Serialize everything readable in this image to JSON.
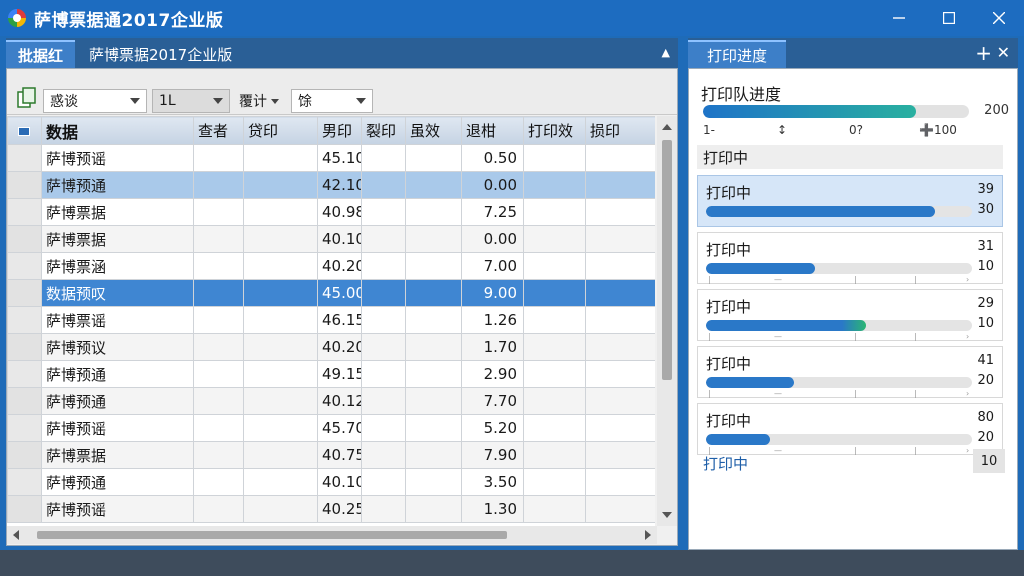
{
  "window": {
    "title": "萨博票据通2017企业版",
    "controls": [
      "minimize",
      "maximize",
      "close"
    ]
  },
  "doc_tabs": [
    {
      "label": "批据红"
    },
    {
      "label": "萨博票据2017企业版"
    }
  ],
  "toolbar": {
    "icon": "document-copy-icon",
    "combo1": "惑谈",
    "combo2": "1L",
    "label1": "覆计",
    "combo3": "馀"
  },
  "grid": {
    "headers": [
      "数据",
      "查者",
      "贷印",
      "男印",
      "裂印",
      "虽效",
      "退柑",
      "打印效",
      "损印"
    ],
    "rows": [
      [
        "萨博预谣",
        "",
        "",
        "45.10",
        "",
        "",
        "0.50",
        "",
        ""
      ],
      [
        "萨博预通",
        "",
        "",
        "42.10",
        "",
        "",
        "0.00",
        "",
        ""
      ],
      [
        "萨博票据",
        "",
        "",
        "40.98",
        "",
        "",
        "7.25",
        "",
        ""
      ],
      [
        "萨博票据",
        "",
        "",
        "40.10",
        "",
        "",
        "0.00",
        "",
        ""
      ],
      [
        "萨博票涵",
        "",
        "",
        "40.20",
        "",
        "",
        "7.00",
        "",
        ""
      ],
      [
        "数据预叹",
        "",
        "",
        "45.00",
        "",
        "",
        "9.00",
        "",
        ""
      ],
      [
        "萨博票谣",
        "",
        "",
        "46.15",
        "",
        "",
        "1.26",
        "",
        ""
      ],
      [
        "萨博预议",
        "",
        "",
        "40.20",
        "",
        "",
        "1.70",
        "",
        ""
      ],
      [
        "萨博预通",
        "",
        "",
        "49.15",
        "",
        "",
        "2.90",
        "",
        ""
      ],
      [
        "萨博预通",
        "",
        "",
        "40.12",
        "",
        "",
        "7.70",
        "",
        ""
      ],
      [
        "萨博预谣",
        "",
        "",
        "45.70",
        "",
        "",
        "5.20",
        "",
        ""
      ],
      [
        "萨博票据",
        "",
        "",
        "40.75",
        "",
        "",
        "7.90",
        "",
        ""
      ],
      [
        "萨博预通",
        "",
        "",
        "40.10",
        "",
        "",
        "3.50",
        "",
        ""
      ],
      [
        "萨博预谣",
        "",
        "",
        "40.25",
        "",
        "",
        "1.30",
        "",
        ""
      ]
    ],
    "highlight_light_row": 1,
    "highlight_strong_row": 5
  },
  "right_panel": {
    "tab_label": "打印进度",
    "queue_title": "打印队进度",
    "queue_progress": 0.8,
    "queue_max": "200",
    "queue_ticks": [
      "1-",
      "↕",
      "0?",
      "➕100"
    ],
    "section_title": "打印中",
    "jobs": [
      {
        "name": "打印中",
        "top": "39",
        "bottom": "30",
        "progress": 0.86,
        "green": false
      },
      {
        "name": "打印中",
        "top": "31",
        "bottom": "10",
        "progress": 0.41,
        "green": false
      },
      {
        "name": "打印中",
        "top": "29",
        "bottom": "10",
        "progress": 0.6,
        "green": true
      },
      {
        "name": "打印中",
        "top": "41",
        "bottom": "20",
        "progress": 0.33,
        "green": false
      },
      {
        "name": "打印中",
        "top": "80",
        "bottom": "20",
        "progress": 0.24,
        "green": false
      }
    ],
    "footer_label": "打印中",
    "footer_badge": "10"
  }
}
